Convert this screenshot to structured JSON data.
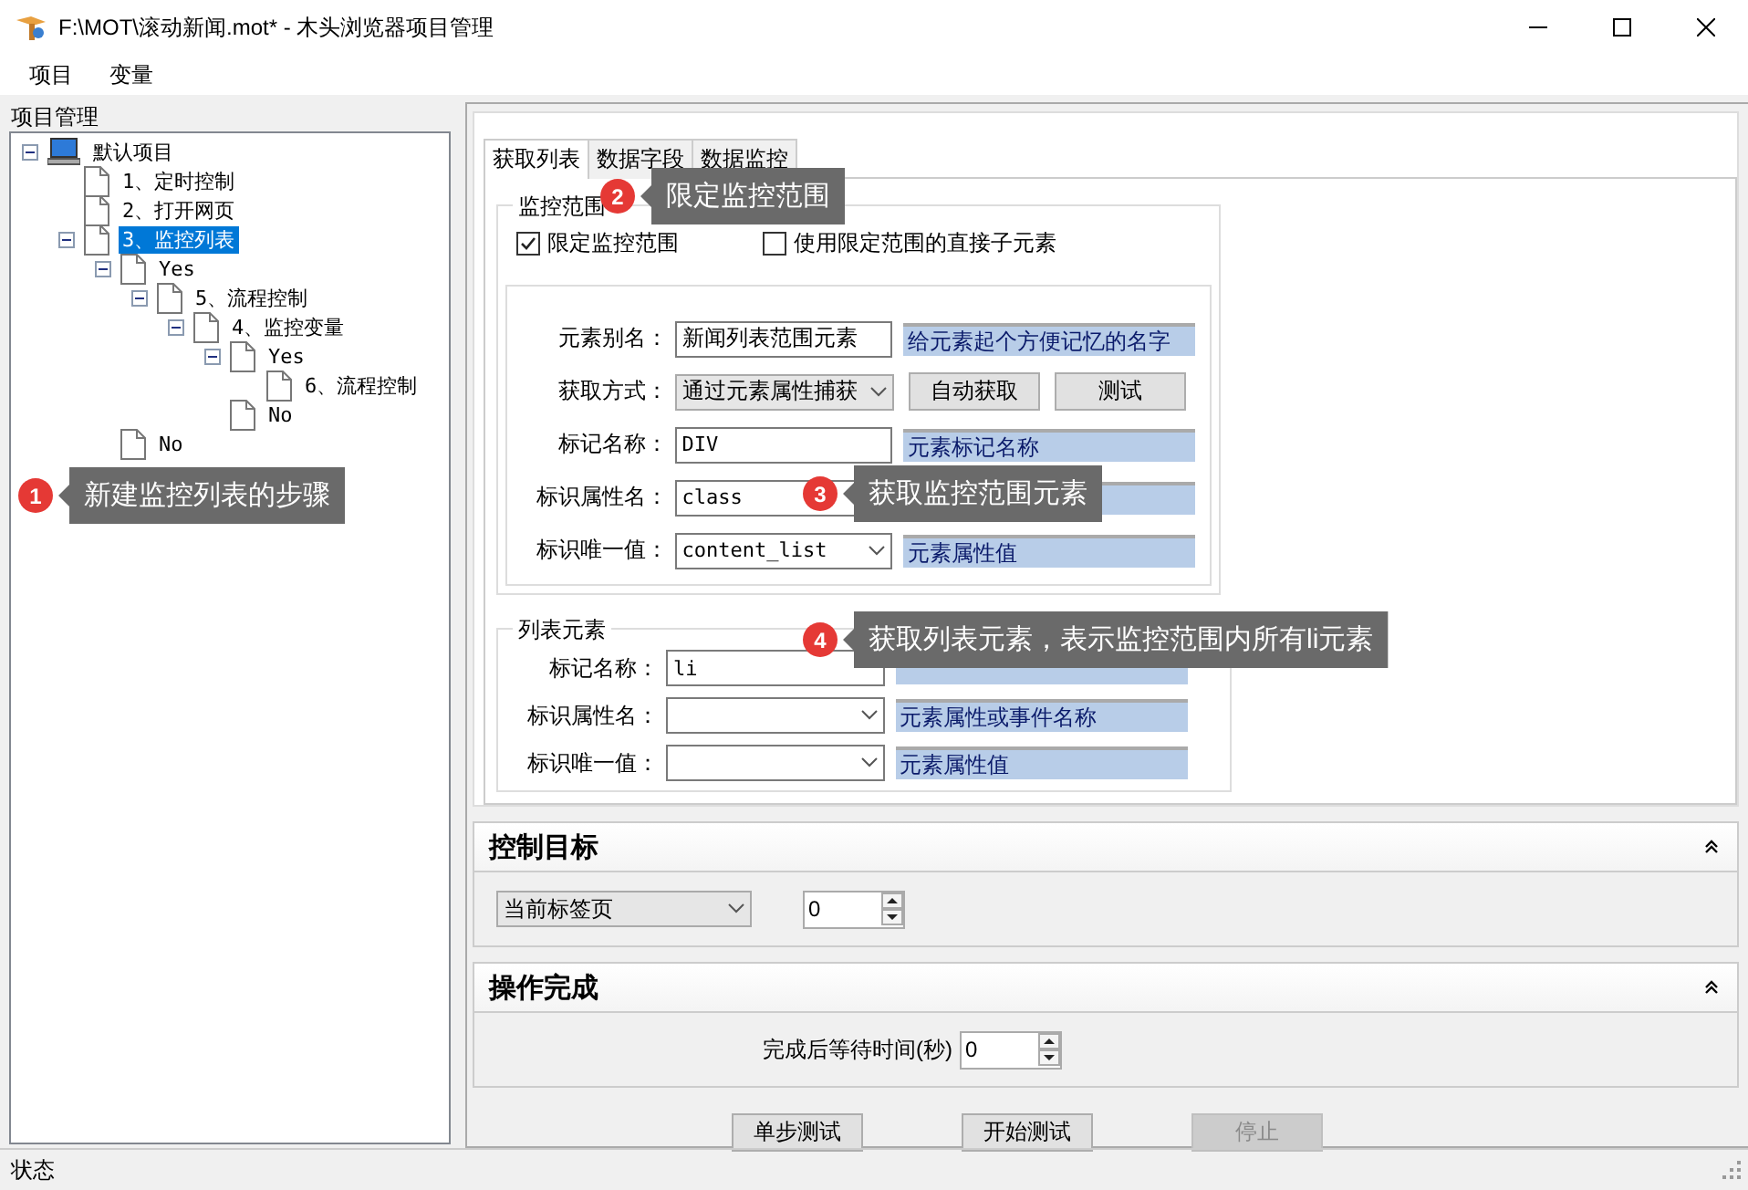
{
  "window": {
    "title": "F:\\MOT\\滚动新闻.mot* - 木头浏览器项目管理"
  },
  "menu": [
    "项目",
    "变量"
  ],
  "sidebar": {
    "title": "项目管理",
    "tree": [
      {
        "label": "默认项目",
        "kind": "project",
        "expanded": true,
        "selected": false,
        "children": [
          {
            "label": "1、定时控制",
            "kind": "step",
            "selected": false
          },
          {
            "label": "2、打开网页",
            "kind": "step",
            "selected": false
          },
          {
            "label": "3、监控列表",
            "kind": "step",
            "selected": true,
            "expanded": true,
            "children": [
              {
                "label": "Yes",
                "kind": "step",
                "selected": false,
                "expanded": true,
                "children": [
                  {
                    "label": "5、流程控制",
                    "kind": "step",
                    "selected": false,
                    "expanded": true,
                    "children": [
                      {
                        "label": "4、监控变量",
                        "kind": "step",
                        "selected": false,
                        "expanded": true,
                        "children": [
                          {
                            "label": "Yes",
                            "kind": "step",
                            "selected": false,
                            "expanded": true,
                            "children": [
                              {
                                "label": "6、流程控制",
                                "kind": "step",
                                "selected": false
                              }
                            ]
                          },
                          {
                            "label": "No",
                            "kind": "step",
                            "selected": false
                          }
                        ]
                      }
                    ]
                  }
                ]
              },
              {
                "label": "No",
                "kind": "step",
                "selected": false
              }
            ]
          }
        ]
      }
    ]
  },
  "tabs": [
    {
      "label": "获取列表",
      "selected": true
    },
    {
      "label": "数据字段",
      "selected": false
    },
    {
      "label": "数据监控",
      "selected": false
    }
  ],
  "monitor_scope": {
    "legend": "监控范围",
    "checkboxes": [
      {
        "label": "限定监控范围",
        "checked": true
      },
      {
        "label": "使用限定范围的直接子元素",
        "checked": false
      }
    ],
    "fields": [
      {
        "label": "元素别名：",
        "kind": "text",
        "value": "新闻列表范围元素",
        "hint": "给元素起个方便记忆的名字"
      },
      {
        "label": "获取方式：",
        "kind": "select",
        "value": "通过元素属性捕获",
        "buttons": [
          "自动获取",
          "测试"
        ]
      },
      {
        "label": "标记名称：",
        "kind": "text",
        "value": "DIV",
        "hint": "元素标记名称"
      },
      {
        "label": "标识属性名：",
        "kind": "text",
        "value": "class"
      },
      {
        "label": "标识唯一值：",
        "kind": "combo",
        "value": "content_list",
        "hint": "元素属性值"
      }
    ]
  },
  "list_element": {
    "legend": "列表元素",
    "fields": [
      {
        "label": "标记名称：",
        "kind": "text",
        "value": "li"
      },
      {
        "label": "标识属性名：",
        "kind": "combo",
        "hint": "元素属性或事件名称"
      },
      {
        "label": "标识唯一值：",
        "kind": "combo",
        "hint": "元素属性值"
      }
    ]
  },
  "control_target": {
    "title": "控制目标",
    "select": "当前标签页",
    "spin": "0"
  },
  "completion": {
    "title": "操作完成",
    "label": "完成后等待时间(秒)",
    "spin": "0"
  },
  "buttons": [
    {
      "label": "单步测试",
      "disabled": false
    },
    {
      "label": "开始测试",
      "disabled": false
    },
    {
      "label": "停止",
      "disabled": true
    }
  ],
  "callouts": [
    {
      "number": "1",
      "text": "新建监控列表的步骤"
    },
    {
      "number": "2",
      "text": "限定监控范围"
    },
    {
      "number": "3",
      "text": "获取监控范围元素"
    },
    {
      "number": "4",
      "text": "获取列表元素，表示监控范围内所有li元素"
    }
  ],
  "status_bar": "状态"
}
